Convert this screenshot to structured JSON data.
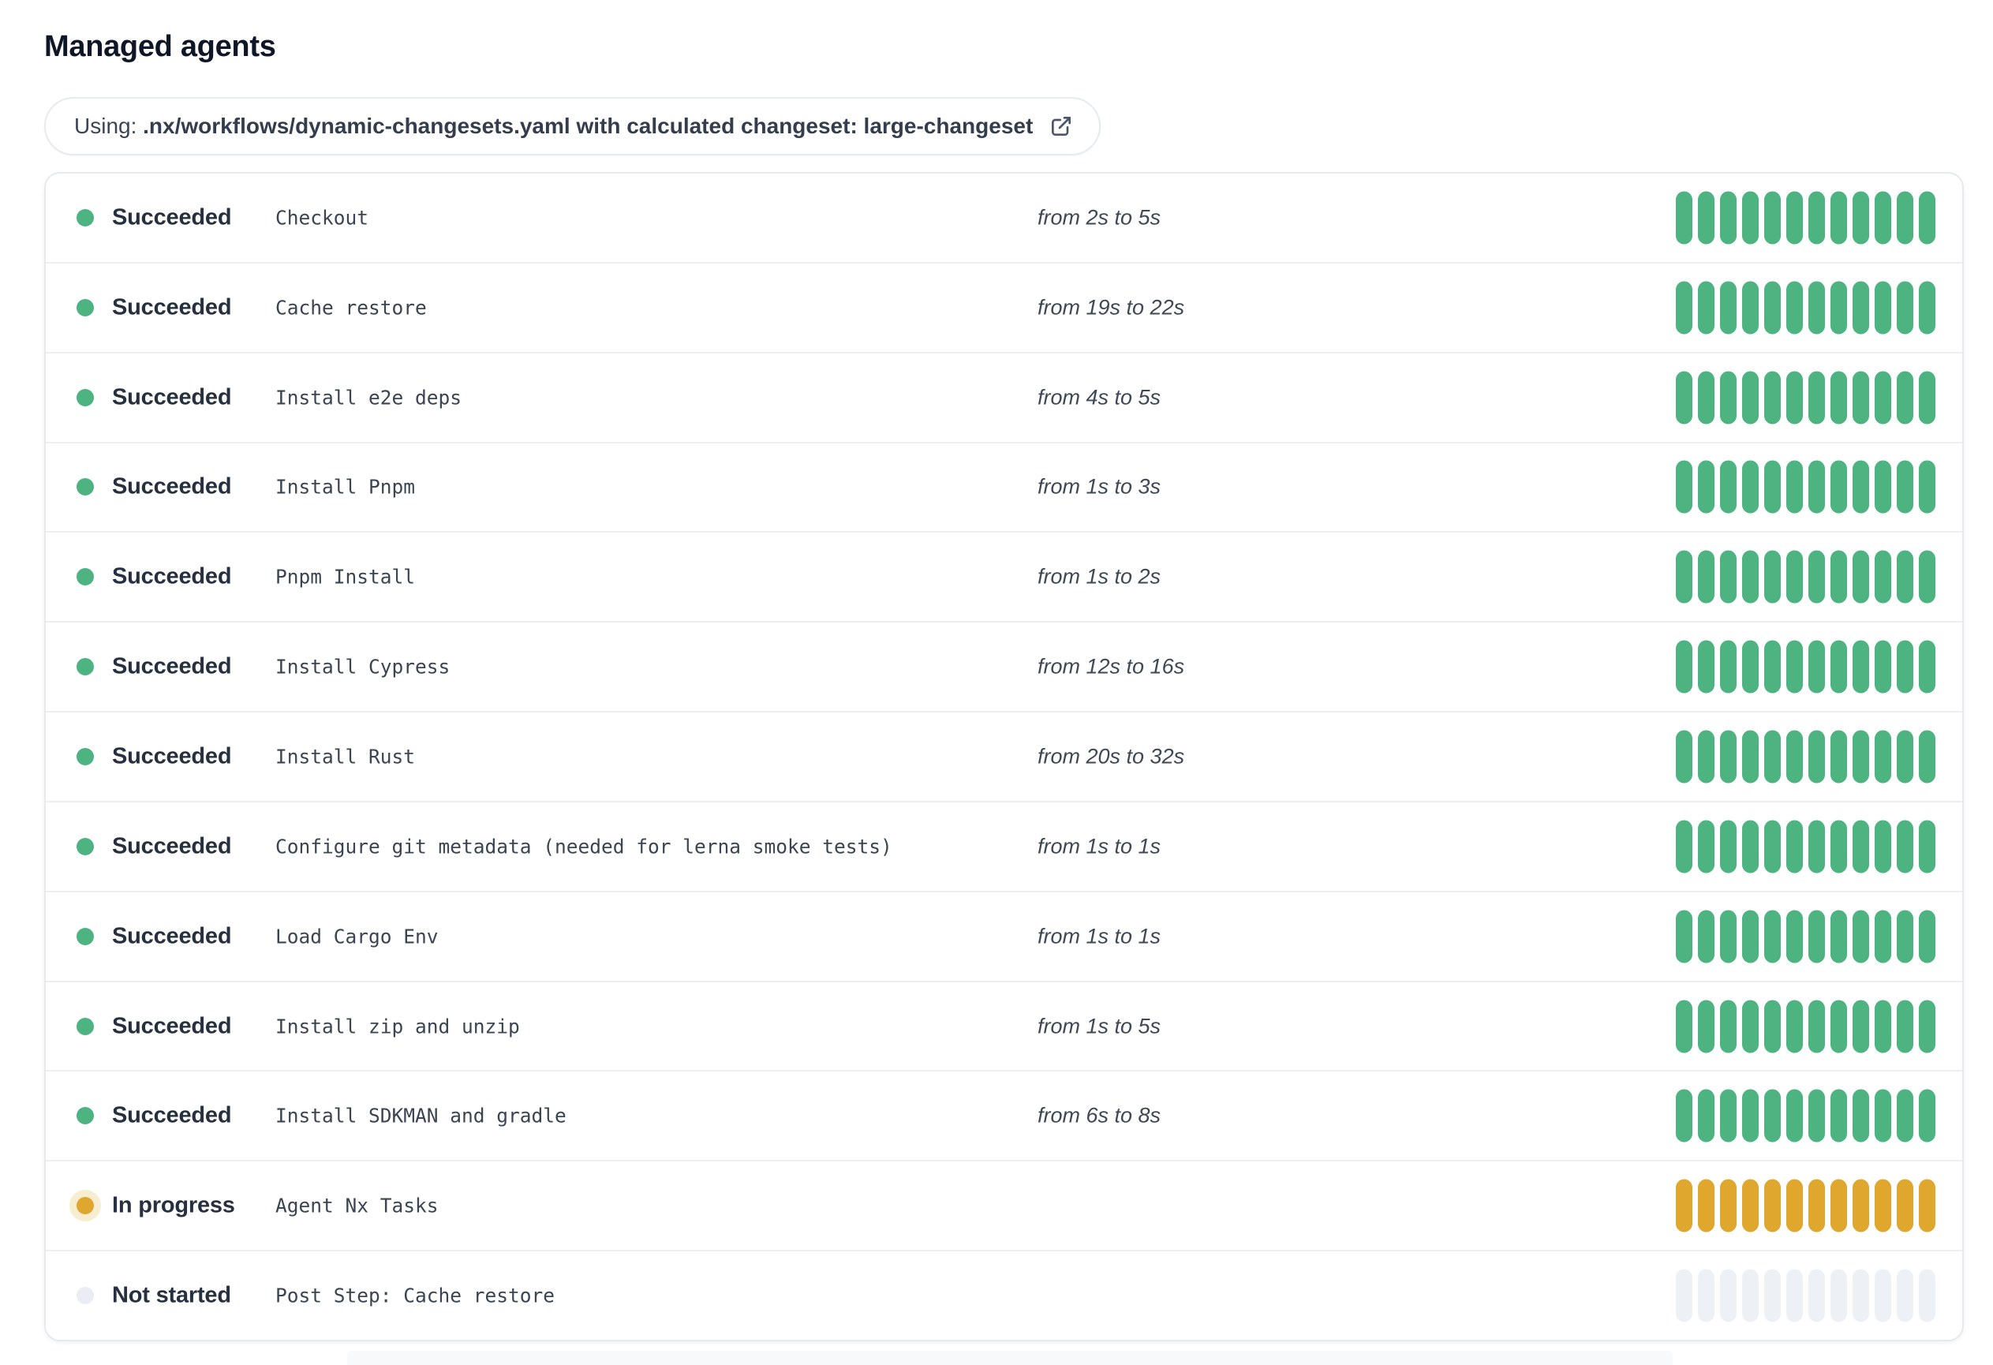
{
  "title": "Managed agents",
  "badge": {
    "prefix": "Using: ",
    "emphasis": ".nx/workflows/dynamic-changesets.yaml with calculated changeset: large-changeset"
  },
  "colors": {
    "succeeded": "#4cb381",
    "in_progress": "#dfa72d",
    "in_progress_halo": "#f7eed2",
    "not_started": "#edf1f6",
    "not_started_dot": "#eaeef4"
  },
  "segment_count": 12,
  "statuses": {
    "succeeded": {
      "label": "Succeeded"
    },
    "in_progress": {
      "label": "In progress"
    },
    "not_started": {
      "label": "Not started"
    }
  },
  "rows": [
    {
      "state": "succeeded",
      "status": "Succeeded",
      "name": "Checkout",
      "duration": "from 2s to 5s"
    },
    {
      "state": "succeeded",
      "status": "Succeeded",
      "name": "Cache restore",
      "duration": "from 19s to 22s"
    },
    {
      "state": "succeeded",
      "status": "Succeeded",
      "name": "Install e2e deps",
      "duration": "from 4s to 5s"
    },
    {
      "state": "succeeded",
      "status": "Succeeded",
      "name": "Install Pnpm",
      "duration": "from 1s to 3s"
    },
    {
      "state": "succeeded",
      "status": "Succeeded",
      "name": "Pnpm Install",
      "duration": "from 1s to 2s"
    },
    {
      "state": "succeeded",
      "status": "Succeeded",
      "name": "Install Cypress",
      "duration": "from 12s to 16s"
    },
    {
      "state": "succeeded",
      "status": "Succeeded",
      "name": "Install Rust",
      "duration": "from 20s to 32s"
    },
    {
      "state": "succeeded",
      "status": "Succeeded",
      "name": "Configure git metadata (needed for lerna smoke tests)",
      "duration": "from 1s to 1s"
    },
    {
      "state": "succeeded",
      "status": "Succeeded",
      "name": "Load Cargo Env",
      "duration": "from 1s to 1s"
    },
    {
      "state": "succeeded",
      "status": "Succeeded",
      "name": "Install zip and unzip",
      "duration": "from 1s to 5s"
    },
    {
      "state": "succeeded",
      "status": "Succeeded",
      "name": "Install SDKMAN and gradle",
      "duration": "from 6s to 8s"
    },
    {
      "state": "in_progress",
      "status": "In progress",
      "name": "Agent Nx Tasks",
      "duration": ""
    },
    {
      "state": "not_started",
      "status": "Not started",
      "name": "Post Step: Cache restore",
      "duration": ""
    }
  ]
}
